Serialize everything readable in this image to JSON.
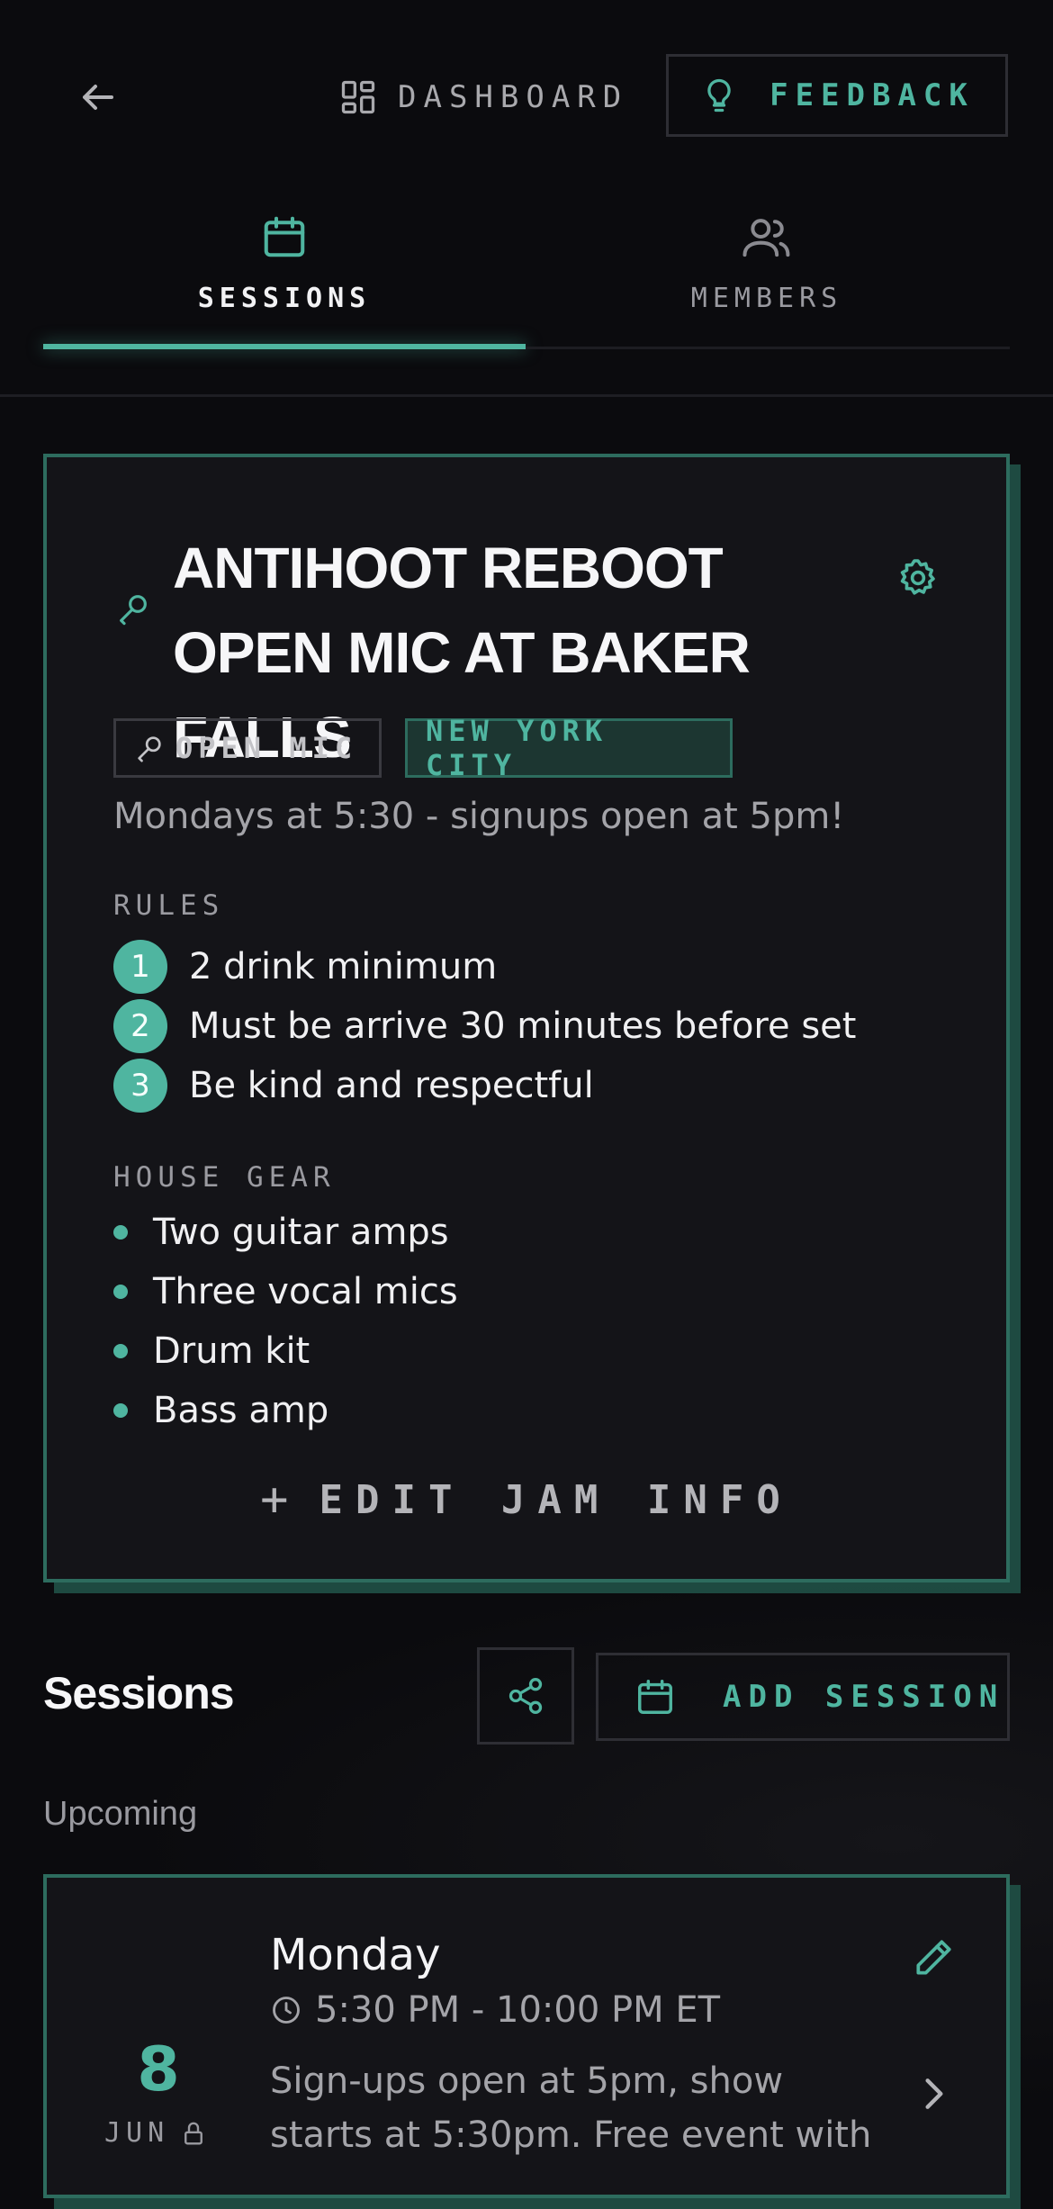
{
  "header": {
    "dashboard_label": "DASHBOARD",
    "feedback_label": "FEEDBACK"
  },
  "tabs": [
    {
      "label": "SESSIONS",
      "active": true,
      "icon": "calendar-icon"
    },
    {
      "label": "MEMBERS",
      "active": false,
      "icon": "users-icon"
    }
  ],
  "jam": {
    "title": "ANTIHOOT REBOOT OPEN MIC AT BAKER FALLS",
    "type_chip": "OPEN MIC",
    "city_chip": "NEW YORK CITY",
    "schedule": "Mondays at 5:30 - signups open at 5pm!",
    "rules_label": "RULES",
    "rules": [
      {
        "num": "1",
        "text": "2 drink minimum"
      },
      {
        "num": "2",
        "text": "Must be arrive 30 minutes before set"
      },
      {
        "num": "3",
        "text": "Be kind and respectful"
      }
    ],
    "house_gear_label": "HOUSE GEAR",
    "house_gear": [
      "Two guitar amps",
      "Three vocal mics",
      "Drum kit",
      "Bass amp"
    ],
    "edit_label": "EDIT JAM INFO"
  },
  "sessions": {
    "heading": "Sessions",
    "add_label": "ADD SESSION",
    "upcoming_label": "Upcoming",
    "items": [
      {
        "day_number": "8",
        "month": "JUN",
        "weekday": "Monday",
        "time": "5:30 PM - 10:00 PM ET",
        "description": "Sign-ups open at 5pm, show starts at 5:30pm. Free event with"
      }
    ]
  },
  "colors": {
    "accent": "#4fb5a0",
    "card_border": "#2d6c5e",
    "background": "#0b0b0e",
    "card_bg": "#141418"
  }
}
